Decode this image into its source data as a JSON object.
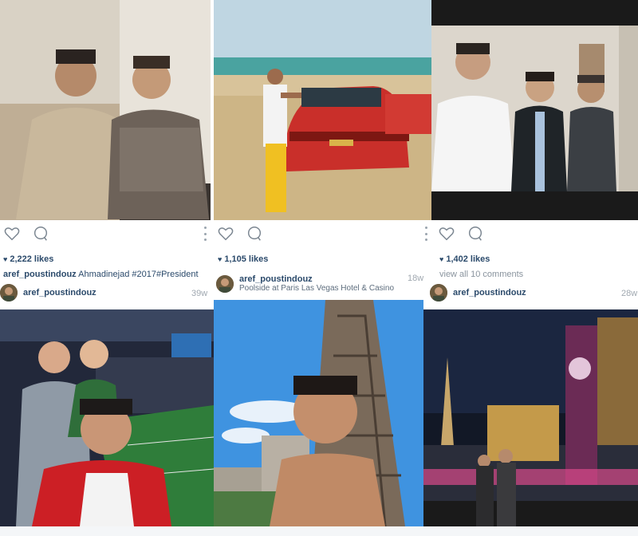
{
  "posts": [
    {
      "likes": "2,222 likes",
      "username": "aref_poustindouz",
      "caption": "Ahmadinejad #2017#President"
    },
    {
      "likes": "1,105 likes"
    },
    {
      "likes": "1,402 likes",
      "comments_link": "view all 10 comments"
    }
  ],
  "profiles": [
    {
      "username": "aref_poustindouz",
      "age": "39w"
    },
    {
      "username": "aref_poustindouz",
      "location": "Poolside at Paris Las Vegas Hotel & Casino",
      "age": "18w"
    },
    {
      "username": "aref_poustindouz",
      "age": "28w"
    }
  ],
  "photos": [
    {
      "description": "Two men in a room"
    },
    {
      "description": "Man posing next to red convertible on beach"
    },
    {
      "description": "Three men in a decorated hall"
    },
    {
      "description": "Group selfie at stadium"
    },
    {
      "description": "Shirtless selfie in front of Eiffel Tower replica"
    },
    {
      "description": "Las Vegas strip at night"
    }
  ],
  "colors": {
    "link": "#2b4a6b",
    "muted": "#8a949e"
  }
}
